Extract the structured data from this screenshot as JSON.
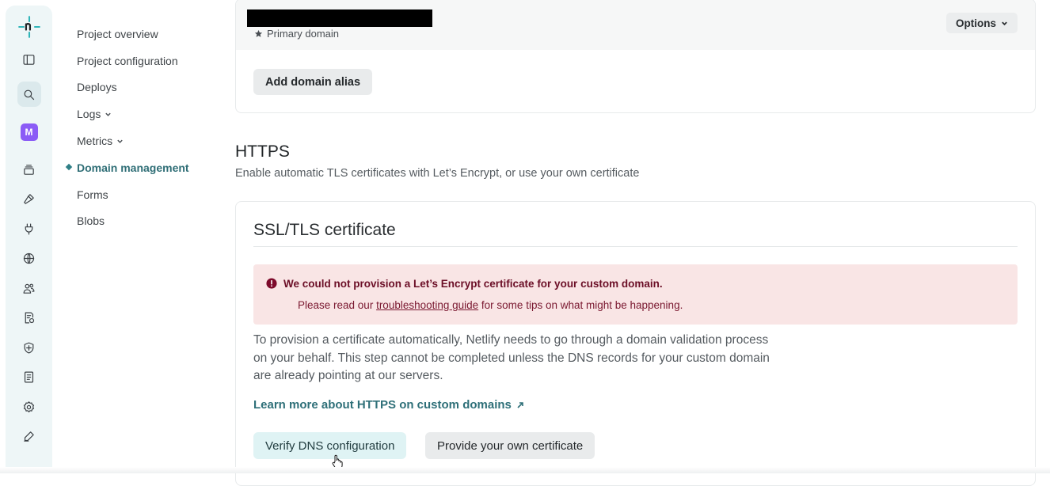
{
  "rail": {
    "avatar_letter": "M",
    "icons": [
      "netlify-logo-icon",
      "sidebar-toggle-icon",
      "search-icon",
      "team-avatar",
      "projects-icon",
      "builds-icon",
      "extensions-icon",
      "domains-icon",
      "members-icon",
      "billing-icon",
      "security-icon",
      "docs-icon",
      "settings-icon",
      "feedback-icon"
    ]
  },
  "subnav": {
    "items": [
      {
        "label": "Project overview"
      },
      {
        "label": "Project configuration"
      },
      {
        "label": "Deploys"
      },
      {
        "label": "Logs"
      },
      {
        "label": "Metrics"
      },
      {
        "label": "Domain management"
      },
      {
        "label": "Forms"
      },
      {
        "label": "Blobs"
      }
    ],
    "active": "Domain management"
  },
  "domain_card": {
    "primary_domain_label": "Primary domain",
    "options_label": "Options",
    "add_alias_label": "Add domain alias"
  },
  "https": {
    "title": "HTTPS",
    "description": "Enable automatic TLS certificates with Let’s Encrypt, or use your own certificate"
  },
  "ssl": {
    "title": "SSL/TLS certificate",
    "alert": {
      "title": "We could not provision a Let’s Encrypt certificate for your custom domain.",
      "body_prefix": "Please read our ",
      "body_link": "troubleshooting guide",
      "body_suffix": " for some tips on what might be happening."
    },
    "body": "To provision a certificate automatically, Netlify needs to go through a domain validation process on your behalf. This step cannot be completed unless the DNS records for your custom domain are already pointing at our servers.",
    "learn_link": "Learn more about HTTPS on custom domains",
    "verify_button": "Verify DNS configuration",
    "own_cert_button": "Provide your own certificate"
  },
  "colors": {
    "accent": "#2f7079",
    "alert_bg": "#f9e5e5",
    "alert_text": "#6b0e26",
    "avatar": "#8b5cf6"
  }
}
